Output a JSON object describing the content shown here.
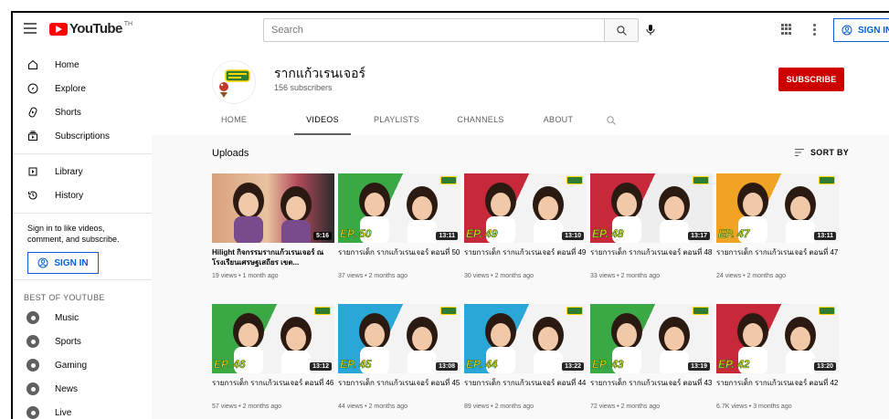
{
  "topbar": {
    "logo_text": "YouTube",
    "region": "TH",
    "search_placeholder": "Search",
    "signin_label": "SIGN IN"
  },
  "sidebar": {
    "items": [
      {
        "label": "Home",
        "icon": "home-icon"
      },
      {
        "label": "Explore",
        "icon": "explore-icon"
      },
      {
        "label": "Shorts",
        "icon": "shorts-icon"
      },
      {
        "label": "Subscriptions",
        "icon": "subscriptions-icon"
      }
    ],
    "items2": [
      {
        "label": "Library",
        "icon": "library-icon"
      },
      {
        "label": "History",
        "icon": "history-icon"
      }
    ],
    "signin_prompt": "Sign in to like videos, comment, and subscribe.",
    "signin_label": "SIGN IN",
    "best_heading": "BEST OF YOUTUBE",
    "best_items": [
      {
        "label": "Music",
        "icon": "music-icon"
      },
      {
        "label": "Sports",
        "icon": "sports-icon"
      },
      {
        "label": "Gaming",
        "icon": "gaming-icon"
      },
      {
        "label": "News",
        "icon": "news-icon"
      },
      {
        "label": "Live",
        "icon": "live-icon"
      }
    ]
  },
  "channel": {
    "name": "รากแก้วเรนเจอร์",
    "subscribers": "156 subscribers",
    "subscribe_label": "SUBSCRIBE",
    "tabs": [
      "HOME",
      "VIDEOS",
      "PLAYLISTS",
      "CHANNELS",
      "ABOUT"
    ],
    "active_tab": "VIDEOS"
  },
  "content": {
    "section_title": "Uploads",
    "sort_label": "SORT BY",
    "videos": [
      {
        "title": "Hilight กิจกรรมรากแก้วเรนเจอร์ ณ โรงเรียนเศรษฐเสถียร เขต...",
        "meta": "19 views • 1 month ago",
        "duration": "5:16",
        "ep": "",
        "bold": true,
        "colors": [
          "#d9a17e",
          "#b24a5a"
        ]
      },
      {
        "title": "รายการเด็ก รากแก้วเรนเจอร์ ตอนที่ 50",
        "meta": "37 views • 2 months ago",
        "duration": "13:11",
        "ep": "EP. 50",
        "bold": false,
        "colors": [
          "#3aa845",
          "#f3f3f3"
        ]
      },
      {
        "title": "รายการเด็ก รากแก้วเรนเจอร์ ตอนที่ 49",
        "meta": "30 views • 2 months ago",
        "duration": "13:10",
        "ep": "EP. 49",
        "bold": false,
        "colors": [
          "#c7283a",
          "#f3f3f3"
        ]
      },
      {
        "title": "รายการเด็ก รากแก้วเรนเจอร์ ตอนที่ 48",
        "meta": "33 views • 2 months ago",
        "duration": "13:17",
        "ep": "EP. 48",
        "bold": false,
        "colors": [
          "#c7283a",
          "#eeeeee"
        ]
      },
      {
        "title": "รายการเด็ก รากแก้วเรนเจอร์ ตอนที่ 47",
        "meta": "24 views • 2 months ago",
        "duration": "13:11",
        "ep": "EP. 47",
        "bold": false,
        "colors": [
          "#f0a324",
          "#f3f3f3"
        ]
      },
      {
        "title": "รายการเด็ก รากแก้วเรนเจอร์ ตอนที่ 46",
        "meta": "57 views • 2 months ago",
        "duration": "13:12",
        "ep": "EP. 46",
        "bold": false,
        "colors": [
          "#3aa845",
          "#f3f3f3"
        ]
      },
      {
        "title": "รายการเด็ก รากแก้วเรนเจอร์ ตอนที่ 45",
        "meta": "44 views • 2 months ago",
        "duration": "13:08",
        "ep": "EP. 45",
        "bold": false,
        "colors": [
          "#2aa7d6",
          "#f3f3f3"
        ]
      },
      {
        "title": "รายการเด็ก รากแก้วเรนเจอร์ ตอนที่ 44",
        "meta": "89 views • 2 months ago",
        "duration": "13:22",
        "ep": "EP. 44",
        "bold": false,
        "colors": [
          "#2aa7d6",
          "#f3f3f3"
        ]
      },
      {
        "title": "รายการเด็ก รากแก้วเรนเจอร์ ตอนที่ 43",
        "meta": "72 views • 2 months ago",
        "duration": "13:19",
        "ep": "EP. 43",
        "bold": false,
        "colors": [
          "#3aa845",
          "#f3f3f3"
        ]
      },
      {
        "title": "รายการเด็ก รากแก้วเรนเจอร์ ตอนที่ 42",
        "meta": "6.7K views • 3 months ago",
        "duration": "13:20",
        "ep": "EP. 42",
        "bold": false,
        "colors": [
          "#c7283a",
          "#f3f3f3"
        ]
      }
    ]
  }
}
